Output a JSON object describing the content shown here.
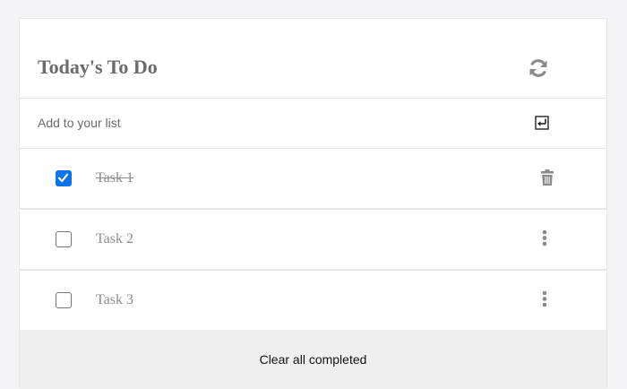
{
  "header": {
    "title": "Today's To Do",
    "refresh_icon": "refresh-icon"
  },
  "add": {
    "placeholder": "Add to your list",
    "value": "",
    "submit_icon": "enter-icon"
  },
  "tasks": [
    {
      "label": "Task 1",
      "completed": true,
      "action_icon": "trash-icon"
    },
    {
      "label": "Task 2",
      "completed": false,
      "action_icon": "more-vertical-icon"
    },
    {
      "label": "Task 3",
      "completed": false,
      "action_icon": "more-vertical-icon"
    }
  ],
  "footer": {
    "clear_label": "Clear all completed"
  },
  "colors": {
    "background": "#f4f3f6",
    "card": "#ffffff",
    "title": "#6b6b6b",
    "checkbox_checked": "#0b74e8",
    "task_text": "#8c8c8c",
    "icon": "#8a8a8a",
    "footer_bg": "#efefef"
  }
}
